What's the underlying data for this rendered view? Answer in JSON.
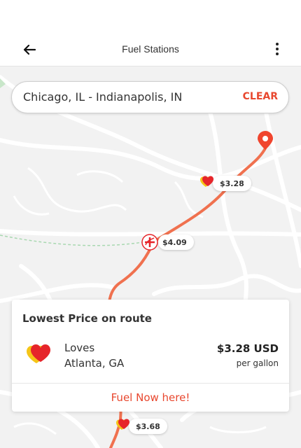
{
  "header": {
    "title": "Fuel Stations",
    "back_icon": "arrow-left-icon",
    "menu_icon": "more-vertical-icon"
  },
  "search": {
    "value": "Chicago, IL - Indianapolis, IN",
    "clear_label": "CLEAR"
  },
  "map": {
    "route_color": "#f0714f",
    "markers": [
      {
        "brand": "Loves",
        "price": "$3.28"
      },
      {
        "brand": "Shell-style",
        "price": "$4.09"
      },
      {
        "brand": "Loves",
        "price": "$3.68"
      }
    ]
  },
  "card": {
    "title": "Lowest Price on route",
    "station_name": "Loves",
    "station_location": "Atlanta, GA",
    "price": "$3.28 USD",
    "price_unit": "per gallon",
    "cta_label": "Fuel Now here!"
  },
  "colors": {
    "accent": "#e8472e",
    "route": "#f0714f",
    "loves_red": "#e6252a",
    "loves_yellow": "#f5c518"
  }
}
